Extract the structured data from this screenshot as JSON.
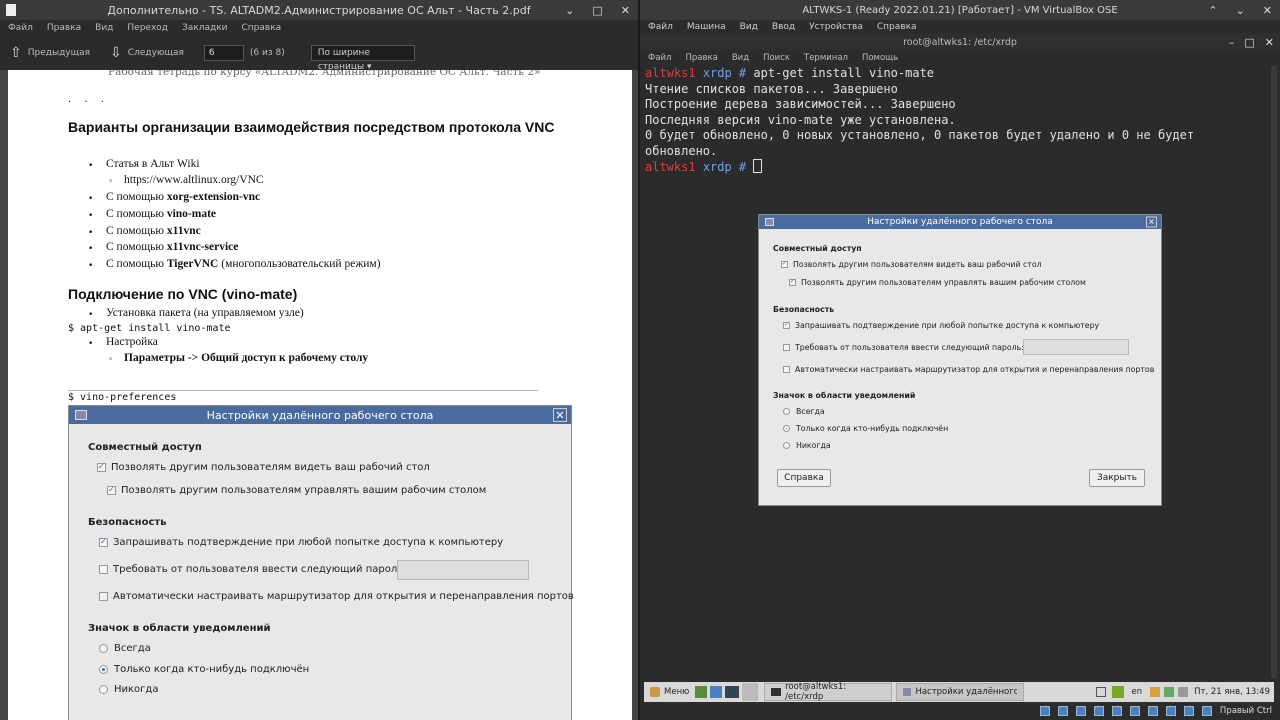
{
  "left_window": {
    "title": "Дополнительно - TS. ALTADM2.Администрирование ОС Альт - Часть 2.pdf",
    "menu": [
      "Файл",
      "Правка",
      "Вид",
      "Переход",
      "Закладки",
      "Справка"
    ],
    "toolbar": {
      "prev_label": "Предыдущая",
      "next_label": "Следующая",
      "page_value": "6",
      "page_of": "(6 из 8)",
      "zoom_value": "По ширине страницы"
    },
    "doc": {
      "header": "Рабочая тетрадь по курсу «ALTADM2. Администрирование ОС Альт. Часть 2»",
      "dots": ". . .",
      "h1": "Варианты организации взаимодействия посредством протокола VNC",
      "items": {
        "wiki": "Статья в Альт Wiki",
        "wiki_url": "https://www.altlinux.org/VNC",
        "opt1_prefix": "С помощью ",
        "opt1_name": "xorg-extension-vnc",
        "opt2_prefix": "С помощью ",
        "opt2_name": "vino-mate",
        "opt3_prefix": "С помощью ",
        "opt3_name": "x11vnc",
        "opt4_prefix": "С помощью ",
        "opt4_name": "x11vnc-service",
        "opt5_prefix": "С помощью ",
        "opt5_name": "TigerVNC",
        "opt5_suffix": " (многопользовательский режим)"
      },
      "h2": "Подключение по VNC (vino-mate)",
      "install_step": "Установка пакета (на управляемом узле)",
      "install_cmd": "$ apt-get install vino-mate",
      "config_step": "Настройка",
      "config_path": "Параметры -> Общий доступ к рабочему столу",
      "prefs_cmd": "$ vino-preferences"
    }
  },
  "dialog": {
    "title": "Настройки удалённого рабочего стола",
    "sharing_header": "Совместный доступ",
    "allow_view": "Позволять другим пользователям видеть ваш рабочий стол",
    "allow_control": "Позволять другим пользователям управлять вашим рабочим столом",
    "security_header": "Безопасность",
    "ask_confirm": "Запрашивать подтверждение при любой попытке доступа к компьютеру",
    "require_pwd": "Требовать от пользователя ввести следующий пароль:",
    "auto_router": "Автоматически настраивать маршрутизатор для открытия и перенаправления портов",
    "notify_header": "Значок в области уведомлений",
    "always": "Всегда",
    "only_connected": "Только когда кто-нибудь подключён",
    "never": "Никогда",
    "help_btn": "Справка",
    "close_btn": "Закрыть"
  },
  "vm_window": {
    "title": "ALTWKS-1 (Ready 2022.01.21) [Работает] - VM VirtualBox OSE",
    "menu": [
      "Файл",
      "Машина",
      "Вид",
      "Ввод",
      "Устройства",
      "Справка"
    ]
  },
  "terminal": {
    "title": "root@altwks1: /etc/xrdp",
    "menu": [
      "Файл",
      "Правка",
      "Вид",
      "Поиск",
      "Терминал",
      "Помощь"
    ],
    "prompt_host": "altwks1",
    "prompt_dir": "xrdp #",
    "cmd": "apt-get install vino-mate",
    "line1": "Чтение списков пакетов... Завершено",
    "line2": "Построение дерева зависимостей... Завершено",
    "line3": "Последняя версия vino-mate уже установлена.",
    "line4": "0 будет обновлено, 0 новых установлено, 0 пакетов будет удалено и 0 не будет",
    "line5": "обновлено."
  },
  "taskbar": {
    "menu_label": "Меню",
    "task1": "root@altwks1: /etc/xrdp",
    "task2": "Настройки удалённого ра...",
    "lang": "en",
    "clock": "Пт, 21 янв, 13:49"
  },
  "status": {
    "host_key": "Правый Ctrl"
  }
}
